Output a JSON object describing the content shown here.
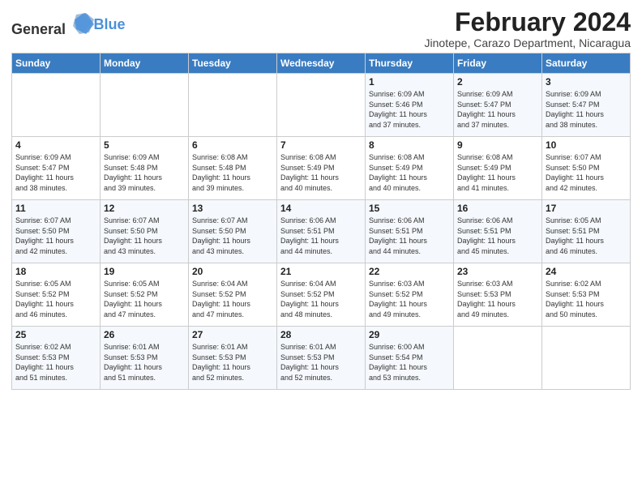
{
  "header": {
    "logo_general": "General",
    "logo_blue": "Blue",
    "title": "February 2024",
    "subtitle": "Jinotepe, Carazo Department, Nicaragua"
  },
  "weekdays": [
    "Sunday",
    "Monday",
    "Tuesday",
    "Wednesday",
    "Thursday",
    "Friday",
    "Saturday"
  ],
  "weeks": [
    [
      {
        "day": "",
        "info": ""
      },
      {
        "day": "",
        "info": ""
      },
      {
        "day": "",
        "info": ""
      },
      {
        "day": "",
        "info": ""
      },
      {
        "day": "1",
        "info": "Sunrise: 6:09 AM\nSunset: 5:46 PM\nDaylight: 11 hours\nand 37 minutes."
      },
      {
        "day": "2",
        "info": "Sunrise: 6:09 AM\nSunset: 5:47 PM\nDaylight: 11 hours\nand 37 minutes."
      },
      {
        "day": "3",
        "info": "Sunrise: 6:09 AM\nSunset: 5:47 PM\nDaylight: 11 hours\nand 38 minutes."
      }
    ],
    [
      {
        "day": "4",
        "info": "Sunrise: 6:09 AM\nSunset: 5:47 PM\nDaylight: 11 hours\nand 38 minutes."
      },
      {
        "day": "5",
        "info": "Sunrise: 6:09 AM\nSunset: 5:48 PM\nDaylight: 11 hours\nand 39 minutes."
      },
      {
        "day": "6",
        "info": "Sunrise: 6:08 AM\nSunset: 5:48 PM\nDaylight: 11 hours\nand 39 minutes."
      },
      {
        "day": "7",
        "info": "Sunrise: 6:08 AM\nSunset: 5:49 PM\nDaylight: 11 hours\nand 40 minutes."
      },
      {
        "day": "8",
        "info": "Sunrise: 6:08 AM\nSunset: 5:49 PM\nDaylight: 11 hours\nand 40 minutes."
      },
      {
        "day": "9",
        "info": "Sunrise: 6:08 AM\nSunset: 5:49 PM\nDaylight: 11 hours\nand 41 minutes."
      },
      {
        "day": "10",
        "info": "Sunrise: 6:07 AM\nSunset: 5:50 PM\nDaylight: 11 hours\nand 42 minutes."
      }
    ],
    [
      {
        "day": "11",
        "info": "Sunrise: 6:07 AM\nSunset: 5:50 PM\nDaylight: 11 hours\nand 42 minutes."
      },
      {
        "day": "12",
        "info": "Sunrise: 6:07 AM\nSunset: 5:50 PM\nDaylight: 11 hours\nand 43 minutes."
      },
      {
        "day": "13",
        "info": "Sunrise: 6:07 AM\nSunset: 5:50 PM\nDaylight: 11 hours\nand 43 minutes."
      },
      {
        "day": "14",
        "info": "Sunrise: 6:06 AM\nSunset: 5:51 PM\nDaylight: 11 hours\nand 44 minutes."
      },
      {
        "day": "15",
        "info": "Sunrise: 6:06 AM\nSunset: 5:51 PM\nDaylight: 11 hours\nand 44 minutes."
      },
      {
        "day": "16",
        "info": "Sunrise: 6:06 AM\nSunset: 5:51 PM\nDaylight: 11 hours\nand 45 minutes."
      },
      {
        "day": "17",
        "info": "Sunrise: 6:05 AM\nSunset: 5:51 PM\nDaylight: 11 hours\nand 46 minutes."
      }
    ],
    [
      {
        "day": "18",
        "info": "Sunrise: 6:05 AM\nSunset: 5:52 PM\nDaylight: 11 hours\nand 46 minutes."
      },
      {
        "day": "19",
        "info": "Sunrise: 6:05 AM\nSunset: 5:52 PM\nDaylight: 11 hours\nand 47 minutes."
      },
      {
        "day": "20",
        "info": "Sunrise: 6:04 AM\nSunset: 5:52 PM\nDaylight: 11 hours\nand 47 minutes."
      },
      {
        "day": "21",
        "info": "Sunrise: 6:04 AM\nSunset: 5:52 PM\nDaylight: 11 hours\nand 48 minutes."
      },
      {
        "day": "22",
        "info": "Sunrise: 6:03 AM\nSunset: 5:52 PM\nDaylight: 11 hours\nand 49 minutes."
      },
      {
        "day": "23",
        "info": "Sunrise: 6:03 AM\nSunset: 5:53 PM\nDaylight: 11 hours\nand 49 minutes."
      },
      {
        "day": "24",
        "info": "Sunrise: 6:02 AM\nSunset: 5:53 PM\nDaylight: 11 hours\nand 50 minutes."
      }
    ],
    [
      {
        "day": "25",
        "info": "Sunrise: 6:02 AM\nSunset: 5:53 PM\nDaylight: 11 hours\nand 51 minutes."
      },
      {
        "day": "26",
        "info": "Sunrise: 6:01 AM\nSunset: 5:53 PM\nDaylight: 11 hours\nand 51 minutes."
      },
      {
        "day": "27",
        "info": "Sunrise: 6:01 AM\nSunset: 5:53 PM\nDaylight: 11 hours\nand 52 minutes."
      },
      {
        "day": "28",
        "info": "Sunrise: 6:01 AM\nSunset: 5:53 PM\nDaylight: 11 hours\nand 52 minutes."
      },
      {
        "day": "29",
        "info": "Sunrise: 6:00 AM\nSunset: 5:54 PM\nDaylight: 11 hours\nand 53 minutes."
      },
      {
        "day": "",
        "info": ""
      },
      {
        "day": "",
        "info": ""
      }
    ]
  ]
}
